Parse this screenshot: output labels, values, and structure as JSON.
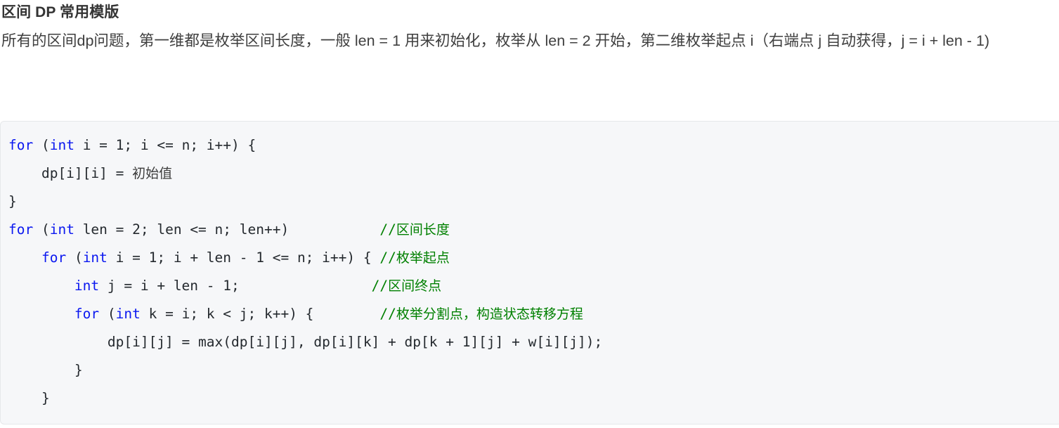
{
  "article": {
    "title": "区间 DP 常用模版",
    "paragraph": "所有的区间dp问题，第一维都是枚举区间长度，一般 len = 1 用来初始化，枚举从 len = 2 开始，第二维枚举起点 i（右端点 j 自动获得，j = i + len - 1)"
  },
  "colors": {
    "keyword": "#0b18f0",
    "comment": "#008000",
    "code_text": "#24292e",
    "code_background": "#f6f7f9",
    "code_border": "#e6e8ea",
    "title_text": "#333333",
    "body_text": "#3f3f3f"
  },
  "code_block": {
    "language": "cpp",
    "lines": [
      {
        "id": "line-1",
        "tokens": [
          {
            "type": "keyword",
            "text": "for"
          },
          {
            "type": "plain",
            "text": " ("
          },
          {
            "type": "keyword",
            "text": "int"
          },
          {
            "type": "plain",
            "text": " i = 1; i <= n; i++) {"
          }
        ]
      },
      {
        "id": "line-2",
        "tokens": [
          {
            "type": "plain",
            "text": "    dp[i][i] = "
          },
          {
            "type": "cjk",
            "text": "初始值"
          }
        ]
      },
      {
        "id": "line-3",
        "tokens": [
          {
            "type": "plain",
            "text": "}"
          }
        ]
      },
      {
        "id": "line-4",
        "tokens": [
          {
            "type": "keyword",
            "text": "for"
          },
          {
            "type": "plain",
            "text": " ("
          },
          {
            "type": "keyword",
            "text": "int"
          },
          {
            "type": "plain",
            "text": " len = 2; len <= n; len++)           "
          },
          {
            "type": "comment",
            "text": "//"
          },
          {
            "type": "comment-cjk",
            "text": "区间长度"
          }
        ]
      },
      {
        "id": "line-5",
        "tokens": [
          {
            "type": "plain",
            "text": "    "
          },
          {
            "type": "keyword",
            "text": "for"
          },
          {
            "type": "plain",
            "text": " ("
          },
          {
            "type": "keyword",
            "text": "int"
          },
          {
            "type": "plain",
            "text": " i = 1; i + len - 1 <= n; i++) { "
          },
          {
            "type": "comment",
            "text": "//"
          },
          {
            "type": "comment-cjk",
            "text": "枚举起点"
          }
        ]
      },
      {
        "id": "line-6",
        "tokens": [
          {
            "type": "plain",
            "text": "        "
          },
          {
            "type": "keyword",
            "text": "int"
          },
          {
            "type": "plain",
            "text": " j = i + len - 1;                "
          },
          {
            "type": "comment",
            "text": "//"
          },
          {
            "type": "comment-cjk",
            "text": "区间终点"
          }
        ]
      },
      {
        "id": "line-7",
        "tokens": [
          {
            "type": "plain",
            "text": "        "
          },
          {
            "type": "keyword",
            "text": "for"
          },
          {
            "type": "plain",
            "text": " ("
          },
          {
            "type": "keyword",
            "text": "int"
          },
          {
            "type": "plain",
            "text": " k = i; k < j; k++) {        "
          },
          {
            "type": "comment",
            "text": "//"
          },
          {
            "type": "comment-cjk",
            "text": "枚举分割点，构造状态转移方程"
          }
        ]
      },
      {
        "id": "line-8",
        "tokens": [
          {
            "type": "plain",
            "text": "            dp[i][j] = max(dp[i][j], dp[i][k] + dp[k + 1][j] + w[i][j]);"
          }
        ]
      },
      {
        "id": "line-9",
        "tokens": [
          {
            "type": "plain",
            "text": "        }"
          }
        ]
      },
      {
        "id": "line-10",
        "tokens": [
          {
            "type": "plain",
            "text": "    }"
          }
        ]
      }
    ]
  }
}
